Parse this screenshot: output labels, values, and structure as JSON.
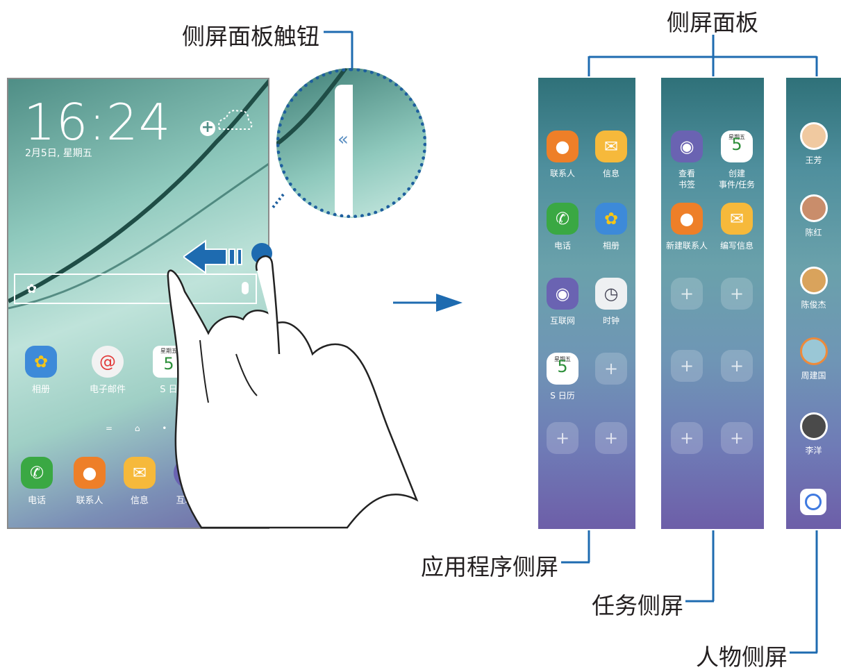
{
  "callouts": {
    "edge_handle": "侧屏面板触钮",
    "edge_panels": "侧屏面板",
    "apps_edge": "应用程序侧屏",
    "tasks_edge": "任务侧屏",
    "people_edge": "人物侧屏"
  },
  "phone": {
    "time": "16:24",
    "date": "2月5日, 星期五",
    "home_apps": [
      {
        "label": "相册",
        "icon": "gallery-icon"
      },
      {
        "label": "电子邮件",
        "icon": "email-icon"
      },
      {
        "label": "S 日",
        "icon": "calendar-icon"
      }
    ],
    "dock_apps": [
      {
        "label": "电话",
        "icon": "phone-icon"
      },
      {
        "label": "联系人",
        "icon": "contacts-icon"
      },
      {
        "label": "信息",
        "icon": "message-icon"
      },
      {
        "label": "互联网",
        "icon": "internet-icon"
      }
    ],
    "calendar_icon_text": {
      "weekday": "星期五",
      "day": "5"
    }
  },
  "apps_edge": {
    "items": [
      {
        "label": "联系人",
        "icon": "contacts-icon"
      },
      {
        "label": "信息",
        "icon": "message-icon"
      },
      {
        "label": "电话",
        "icon": "phone-icon"
      },
      {
        "label": "相册",
        "icon": "gallery-icon"
      },
      {
        "label": "互联网",
        "icon": "internet-icon"
      },
      {
        "label": "时钟",
        "icon": "clock-icon"
      },
      {
        "label": "S 日历",
        "icon": "calendar-icon"
      }
    ]
  },
  "tasks_edge": {
    "items": [
      {
        "label_line1": "查看",
        "label_line2": "书签",
        "icon": "bookmark-icon"
      },
      {
        "label_line1": "创建",
        "label_line2": "事件/任务",
        "icon": "calendar-add-icon"
      },
      {
        "label_line1": "新建联系人",
        "label_line2": "",
        "icon": "contact-add-icon"
      },
      {
        "label_line1": "编写信息",
        "label_line2": "",
        "icon": "compose-message-icon"
      }
    ]
  },
  "people_edge": {
    "contacts": [
      "王芳",
      "陈红",
      "陈俊杰",
      "周建国",
      "李洋"
    ],
    "avatar_colors": [
      "#f0c9a0",
      "#c98d6b",
      "#d9a35c",
      "#9ac7d6",
      "#4a4a4a"
    ]
  }
}
